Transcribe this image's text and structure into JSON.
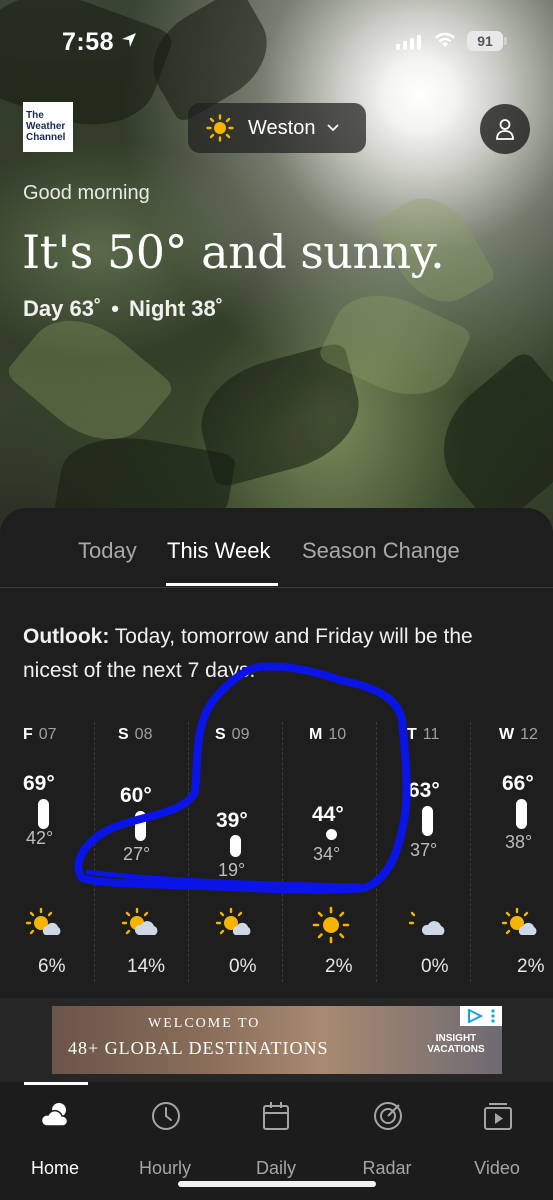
{
  "status_bar": {
    "time": "7:58",
    "battery": "91"
  },
  "header": {
    "logo_text": [
      "The",
      "Weather",
      "Channel"
    ],
    "location": "Weston",
    "location_icon": "sun-icon",
    "profile_icon": "user-icon"
  },
  "hero": {
    "greeting": "Good morning",
    "headline": "It's 50° and sunny.",
    "day_label": "Day 63˚",
    "night_label": "Night 38˚",
    "separator": "•"
  },
  "tabs": [
    {
      "label": "Today",
      "active": false
    },
    {
      "label": "This Week",
      "active": true
    },
    {
      "label": "Season Change",
      "active": false
    }
  ],
  "outlook": {
    "label": "Outlook:",
    "text": "Today, tomorrow and Friday will be the nicest of the next 7 days."
  },
  "forecast": [
    {
      "day": "F",
      "date": "07",
      "high": "69°",
      "low": "42°",
      "icon": "partly-sunny-icon",
      "precip": "6%"
    },
    {
      "day": "S",
      "date": "08",
      "high": "60°",
      "low": "27°",
      "icon": "partly-sunny-icon",
      "precip": "14%"
    },
    {
      "day": "S",
      "date": "09",
      "high": "39°",
      "low": "19°",
      "icon": "partly-sunny-icon",
      "precip": "0%"
    },
    {
      "day": "M",
      "date": "10",
      "high": "44°",
      "low": "34°",
      "icon": "sun-icon",
      "precip": "2%"
    },
    {
      "day": "T",
      "date": "11",
      "high": "63°",
      "low": "37°",
      "icon": "partly-cloudy-icon",
      "precip": "0%"
    },
    {
      "day": "W",
      "date": "12",
      "high": "66°",
      "low": "38°",
      "icon": "partly-sunny-icon",
      "precip": "2%"
    }
  ],
  "ad": {
    "line1": "WELCOME TO",
    "line2": "48+ GLOBAL DESTINATIONS",
    "brand_line1": "INSIGHT",
    "brand_line2": "VACATIONS"
  },
  "nav": [
    {
      "label": "Home",
      "icon": "home-weather-icon",
      "active": true
    },
    {
      "label": "Hourly",
      "icon": "clock-icon",
      "active": false
    },
    {
      "label": "Daily",
      "icon": "calendar-icon",
      "active": false
    },
    {
      "label": "Radar",
      "icon": "radar-icon",
      "active": false
    },
    {
      "label": "Video",
      "icon": "video-icon",
      "active": false
    }
  ],
  "colors": {
    "sun": "#f5b400",
    "annotation": "#0a14e6",
    "panel": "#1e1e1e"
  }
}
